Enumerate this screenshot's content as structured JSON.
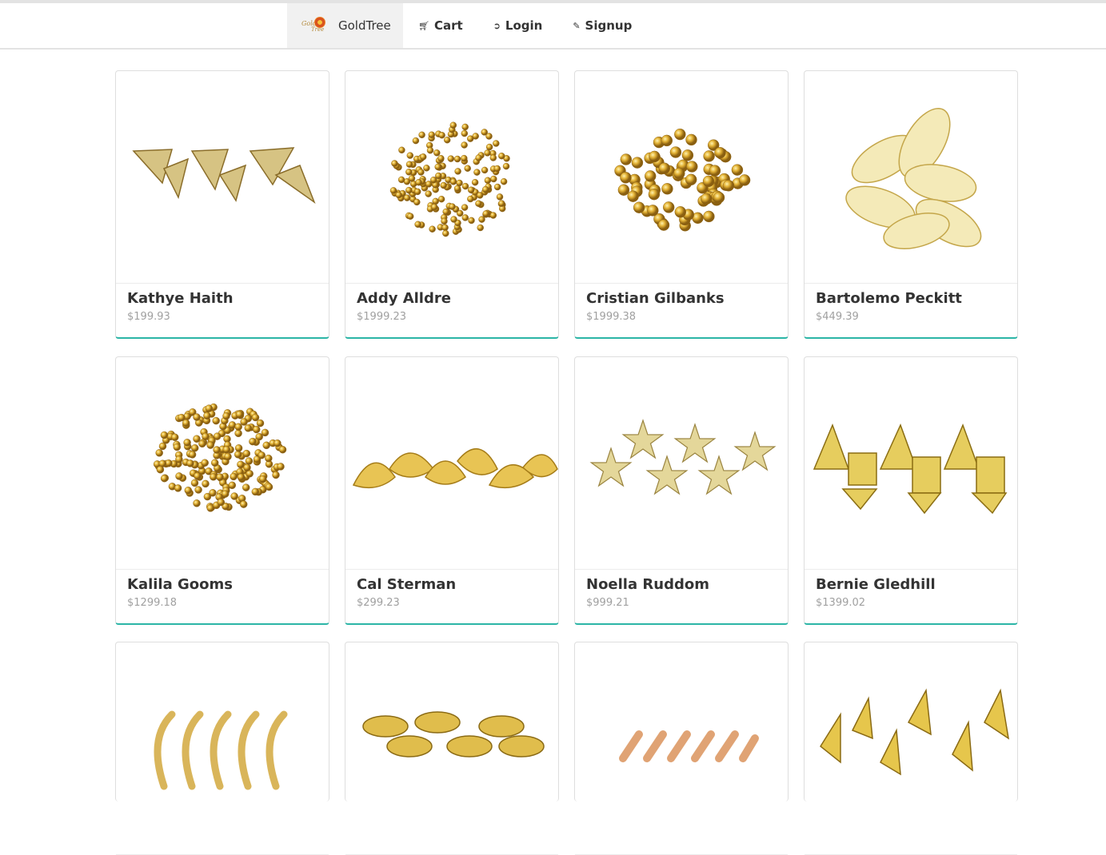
{
  "nav": {
    "brand": "GoldTree",
    "logo_text": [
      "Gold",
      "Tree"
    ],
    "items": [
      {
        "label": "Cart",
        "icon": "cart-icon",
        "glyph": "🛒︎"
      },
      {
        "label": "Login",
        "icon": "sign-in-icon",
        "glyph": "➲"
      },
      {
        "label": "Signup",
        "icon": "edit-icon",
        "glyph": "✎"
      }
    ]
  },
  "products": [
    {
      "name": "Kathye Haith",
      "price": "$199.93",
      "image": "shark-tooth-charms"
    },
    {
      "name": "Addy Alldre",
      "price": "$1999.23",
      "image": "small-gold-beads"
    },
    {
      "name": "Cristian Gilbanks",
      "price": "$1999.38",
      "image": "large-gold-beads"
    },
    {
      "name": "Bartolemo Peckitt",
      "price": "$449.39",
      "image": "filigree-leaf-charms"
    },
    {
      "name": "Kalila Gooms",
      "price": "$1299.18",
      "image": "gold-spacer-beads"
    },
    {
      "name": "Cal Sterman",
      "price": "$299.23",
      "image": "seashell-charms"
    },
    {
      "name": "Noella Ruddom",
      "price": "$999.21",
      "image": "starfish-charms"
    },
    {
      "name": "Bernie Gledhill",
      "price": "$1399.02",
      "image": "fish-skeleton-charms"
    },
    {
      "name": "",
      "price": "",
      "image": "curved-tube-beads"
    },
    {
      "name": "",
      "price": "",
      "image": "cowrie-connectors"
    },
    {
      "name": "",
      "price": "",
      "image": "straight-tube-beads"
    },
    {
      "name": "",
      "price": "",
      "image": "sailboat-charms"
    }
  ],
  "colors": {
    "accent": "#2bb5a6",
    "gold": "#d8b24a"
  }
}
